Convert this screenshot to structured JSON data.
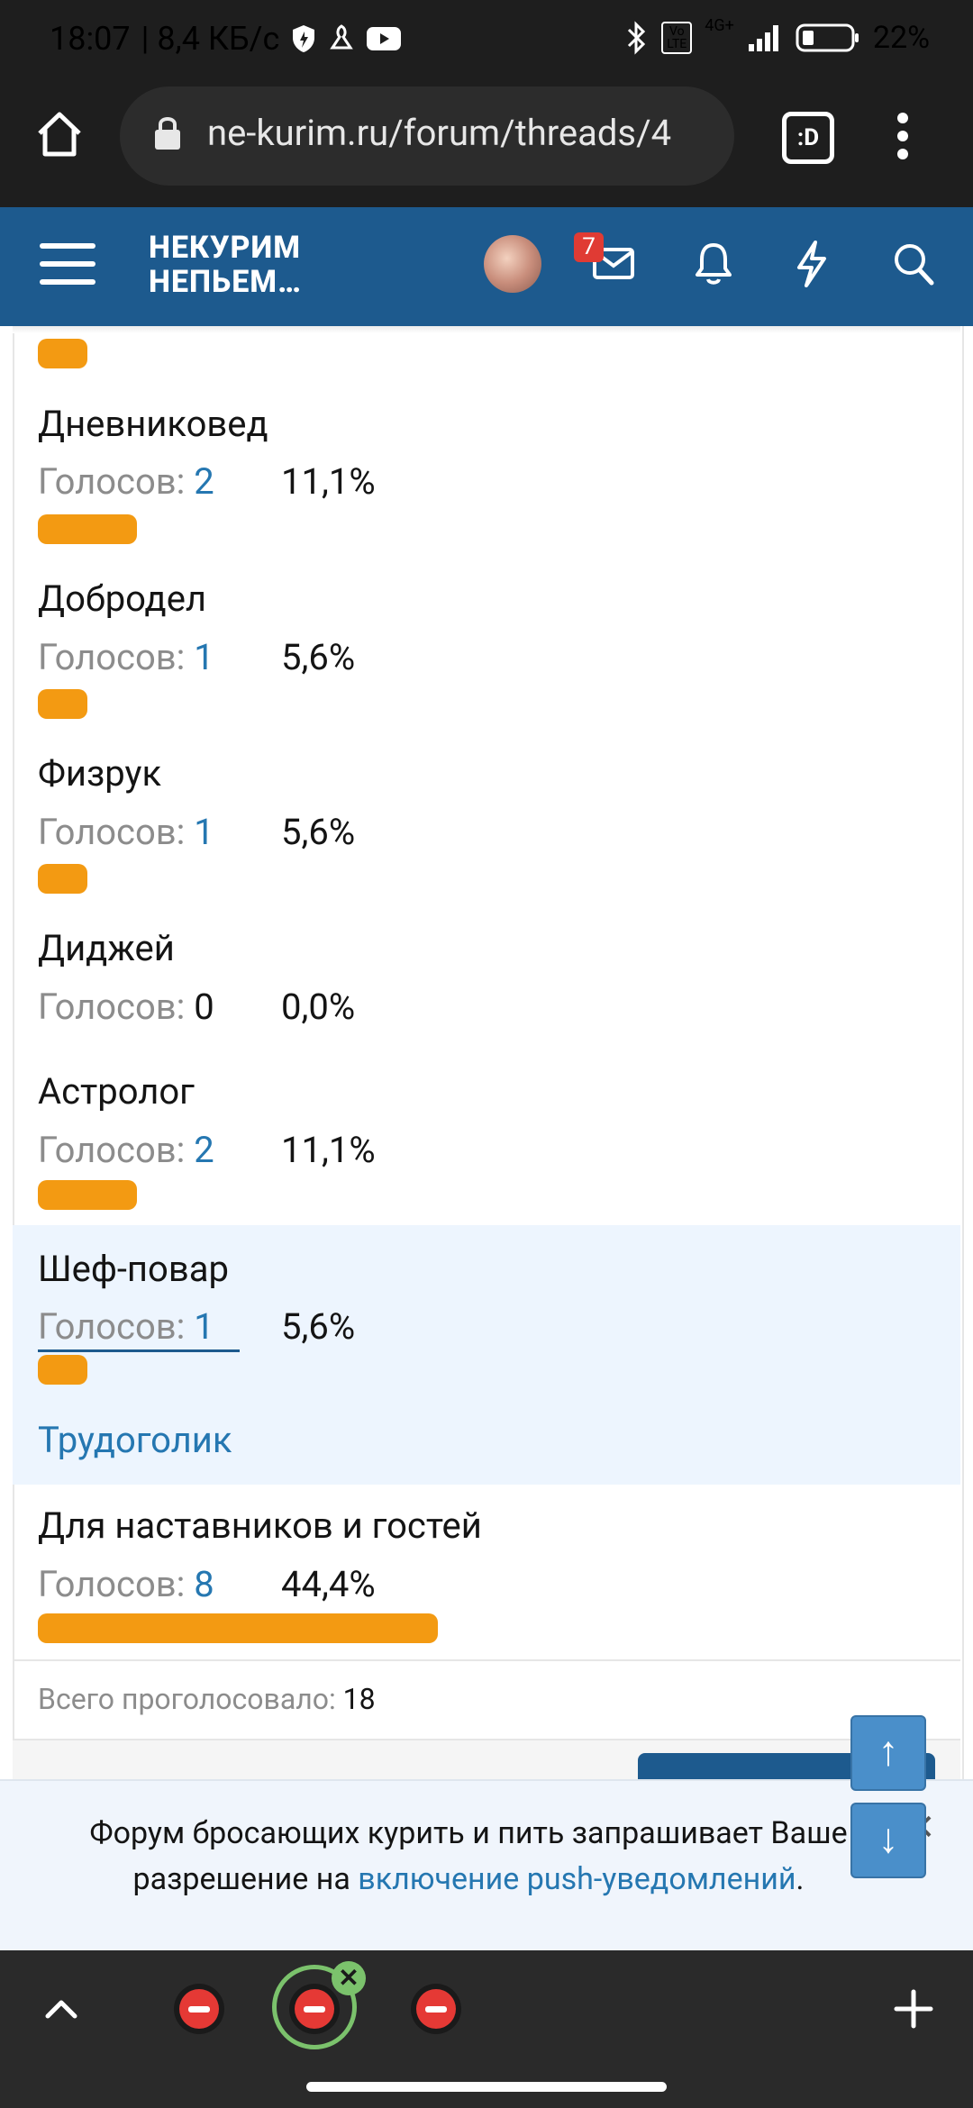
{
  "status_bar": {
    "time": "18:07",
    "speed": "| 8,4 КБ/с",
    "network": "4G+",
    "volte": "Vo LTE",
    "battery": "22%"
  },
  "browser": {
    "url": "ne-kurim.ru/forum/threads/4",
    "tab_switcher_label": ":D"
  },
  "forum_header": {
    "logo_line1": "НЕКУРИМ",
    "logo_line2": "НЕПЬЕМ…",
    "messages_badge": "7"
  },
  "poll": {
    "votes_label": "Голосов:",
    "options": [
      {
        "title": "Дневниковед",
        "votes": "2",
        "percent": "11,1%"
      },
      {
        "title": "Добродел",
        "votes": "1",
        "percent": "5,6%"
      },
      {
        "title": "Физрук",
        "votes": "1",
        "percent": "5,6%"
      },
      {
        "title": "Диджей",
        "votes": "0",
        "percent": "0,0%"
      },
      {
        "title": "Астролог",
        "votes": "2",
        "percent": "11,1%"
      },
      {
        "title": "Шеф-повар",
        "votes": "1",
        "percent": "5,6%"
      },
      {
        "title": "Для наставников и гостей",
        "votes": "8",
        "percent": "44,4%"
      }
    ],
    "voters_tooltip": "Трудоголик",
    "total_label": "Всего проголосовало:",
    "total_value": "18"
  },
  "notice": {
    "text_before": "Форум бросающих курить и пить запрашивает Ваше разрешение на",
    "link": "включение push-уведомлений",
    "text_after": "."
  },
  "colors": {
    "header_bg": "#1d5a8e",
    "bar": "#f39a12",
    "link": "#2577b1",
    "highlight_bg": "#edf5fe"
  }
}
